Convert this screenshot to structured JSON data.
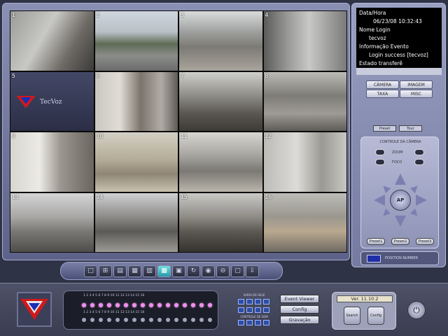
{
  "cameras": [
    {
      "num": "1"
    },
    {
      "num": "2"
    },
    {
      "num": "3"
    },
    {
      "num": "4"
    },
    {
      "num": "5"
    },
    {
      "num": "6"
    },
    {
      "num": "7"
    },
    {
      "num": "8"
    },
    {
      "num": "9"
    },
    {
      "num": "10"
    },
    {
      "num": "11"
    },
    {
      "num": "12"
    },
    {
      "num": "13"
    },
    {
      "num": "14"
    },
    {
      "num": "15"
    },
    {
      "num": "16"
    }
  ],
  "info": {
    "date_label": "Data/Hora",
    "date_value": "06/23/08 10:32:43",
    "login_label": "Nome Login",
    "login_value": "tecvoz",
    "event_label": "Informação Evento",
    "event_value": "Login success [tecvoz]",
    "status_label": "Estado transferê"
  },
  "mode_buttons": [
    "CÂMERA",
    "IMAGEM",
    "TAXA",
    "MISC"
  ],
  "ptz": {
    "tabs": [
      "Preset",
      "Tour"
    ],
    "title": "CONTROLE DA CÂMERA",
    "zoom_label": "ZOOM",
    "focus_label": "FOCO",
    "center_label": "AP",
    "presets": [
      "Preset1",
      "Preset2",
      "Preset3"
    ]
  },
  "channel": {
    "label": "POSITION NUMBER",
    "value": ""
  },
  "logo": {
    "text": "TecVoz",
    "icon": "tecvoz-logo-icon",
    "brand_color": "#d01a1a",
    "accent_color": "#1a2eb8"
  },
  "toolbar_icons": [
    "single-view-icon",
    "quad-view-icon",
    "six-view-icon",
    "nine-view-icon",
    "ten-view-icon",
    "sixteen-view-icon",
    "full-screen-icon",
    "refresh-icon",
    "record-icon",
    "zoom-out-icon",
    "snapshot-icon",
    "export-icon"
  ],
  "dock": {
    "io_title_top": "SAÍDA DE RELÉ",
    "io_title_bottom": "CONTROLE DE SOM",
    "io_numbers": [
      "1",
      "2",
      "3",
      "4"
    ],
    "event_viewer": "Event Viewer",
    "config": "Config",
    "gravacao": "Gravação",
    "version": "Ver. 11.10.2",
    "ver_btn1": "Search",
    "ver_btn2": "Config",
    "power_icon": "power-icon"
  }
}
